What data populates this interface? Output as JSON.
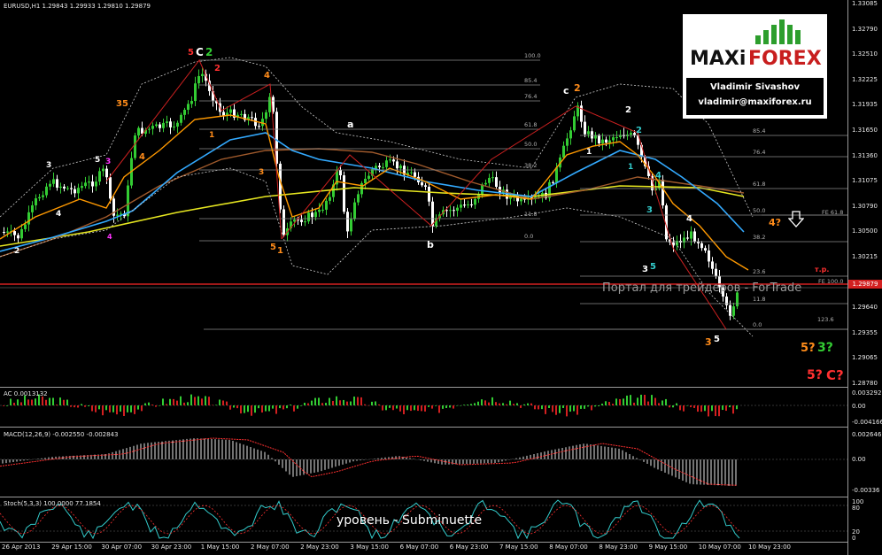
{
  "chart": {
    "title": "EURUSD,H1  1.29843 1.29933 1.29810 1.29879",
    "price_labels": [
      "1.33085",
      "1.32790",
      "1.32510",
      "1.32225",
      "1.31935",
      "1.31650",
      "1.31360",
      "1.31075",
      "1.30790",
      "1.30500",
      "1.30215",
      "1.29930",
      "1.29640",
      "1.29355",
      "1.29065",
      "1.28780"
    ],
    "current_price": "1.29879",
    "time_labels": [
      "26 Apr 2013",
      "29 Apr 15:00",
      "30 Apr 07:00",
      "30 Apr 23:00",
      "1 May 15:00",
      "2 May 07:00",
      "2 May 23:00",
      "3 May 15:00",
      "6 May 07:00",
      "6 May 23:00",
      "7 May 15:00",
      "8 May 07:00",
      "8 May 23:00",
      "9 May 15:00",
      "10 May 07:00",
      "10 May 23:00"
    ],
    "waves": [
      {
        "text": "5",
        "color": "#ff3030"
      },
      {
        "text": "C",
        "color": "#ffffff"
      },
      {
        "text": "2",
        "color": "#33cc33"
      },
      {
        "text": "2",
        "color": "#ff3030"
      },
      {
        "text": "4",
        "color": "#ff8c1a"
      },
      {
        "text": "35",
        "color": "#ff8c1a"
      },
      {
        "text": "5",
        "color": "#ffffff"
      },
      {
        "text": "3",
        "color": "#ff33ff"
      },
      {
        "text": "3",
        "color": "#ffffff"
      },
      {
        "text": "4",
        "color": "#ff8c1a"
      },
      {
        "text": "1",
        "color": "#ff8c1a"
      },
      {
        "text": "4",
        "color": "#ffffff"
      },
      {
        "text": "4",
        "color": "#ff33ff"
      },
      {
        "text": "3",
        "color": "#ff8c1a"
      },
      {
        "text": "2",
        "color": "#ffffff"
      },
      {
        "text": "5",
        "color": "#ff8c1a"
      },
      {
        "text": "1",
        "color": "#ff8c1a"
      },
      {
        "text": "a",
        "color": "#ffffff"
      },
      {
        "text": "b",
        "color": "#ffffff"
      },
      {
        "text": "c",
        "color": "#ffffff"
      },
      {
        "text": "2",
        "color": "#ff8c1a"
      },
      {
        "text": "2",
        "color": "#ffffff"
      },
      {
        "text": "2",
        "color": "#33cccc"
      },
      {
        "text": "1",
        "color": "#ffffff"
      },
      {
        "text": "1",
        "color": "#33cccc"
      },
      {
        "text": "4",
        "color": "#33cccc"
      },
      {
        "text": "3",
        "color": "#33cccc"
      },
      {
        "text": "4",
        "color": "#ffffff"
      },
      {
        "text": "3",
        "color": "#ffffff"
      },
      {
        "text": "5",
        "color": "#33cccc"
      },
      {
        "text": "3",
        "color": "#ff8c1a"
      },
      {
        "text": "5",
        "color": "#ffffff"
      },
      {
        "text": "4?",
        "color": "#ff8c1a"
      },
      {
        "text": "5?",
        "color": "#ff8c1a"
      },
      {
        "text": "3?",
        "color": "#33cc33"
      },
      {
        "text": "5?",
        "color": "#ff3030"
      },
      {
        "text": "C?",
        "color": "#ff3030"
      },
      {
        "text": "т.р.",
        "color": "#ff3030"
      }
    ],
    "fib_left": [
      "100.0",
      "85.4",
      "76.4",
      "61.8",
      "50.0",
      "38.2",
      "11.8",
      "0.0"
    ],
    "fib_right": [
      "85.4",
      "76.4",
      "61.8",
      "50.0",
      "38.2",
      "23.6",
      "11.8",
      "0.0",
      "123.6"
    ],
    "fe_label": "FE 61.8",
    "fe_label2": "FE 100.0"
  },
  "logo": {
    "maxi": "MAXi",
    "forex": "FOREX",
    "name": "Vladimir Sivashov",
    "email": "vladimir@maxiforex.ru"
  },
  "watermark": "Портал для трейдеров - ForTrade",
  "ac": {
    "title": "AC 0.0013132",
    "labels": [
      "0.003292",
      "0.00",
      "-0.004166"
    ]
  },
  "macd": {
    "title": "MACD(12,26,9) -0.002550 -0.002843",
    "labels": [
      "0.002646",
      "0.00",
      "-0.00336"
    ]
  },
  "stoch": {
    "title": "Stoch(5,3,3) 100.0000 77.1854",
    "labels": [
      "100",
      "80",
      "20",
      "0"
    ],
    "caption": "уровень - Subminuette"
  },
  "colors": {
    "bull": "#33cc33",
    "bear": "#ffffff",
    "ma_yellow": "#e6e620",
    "ma_orange": "#ff9900",
    "ma_blue": "#33aaff",
    "ma_brown": "#a05a2c",
    "level_red": "#d32020"
  }
}
